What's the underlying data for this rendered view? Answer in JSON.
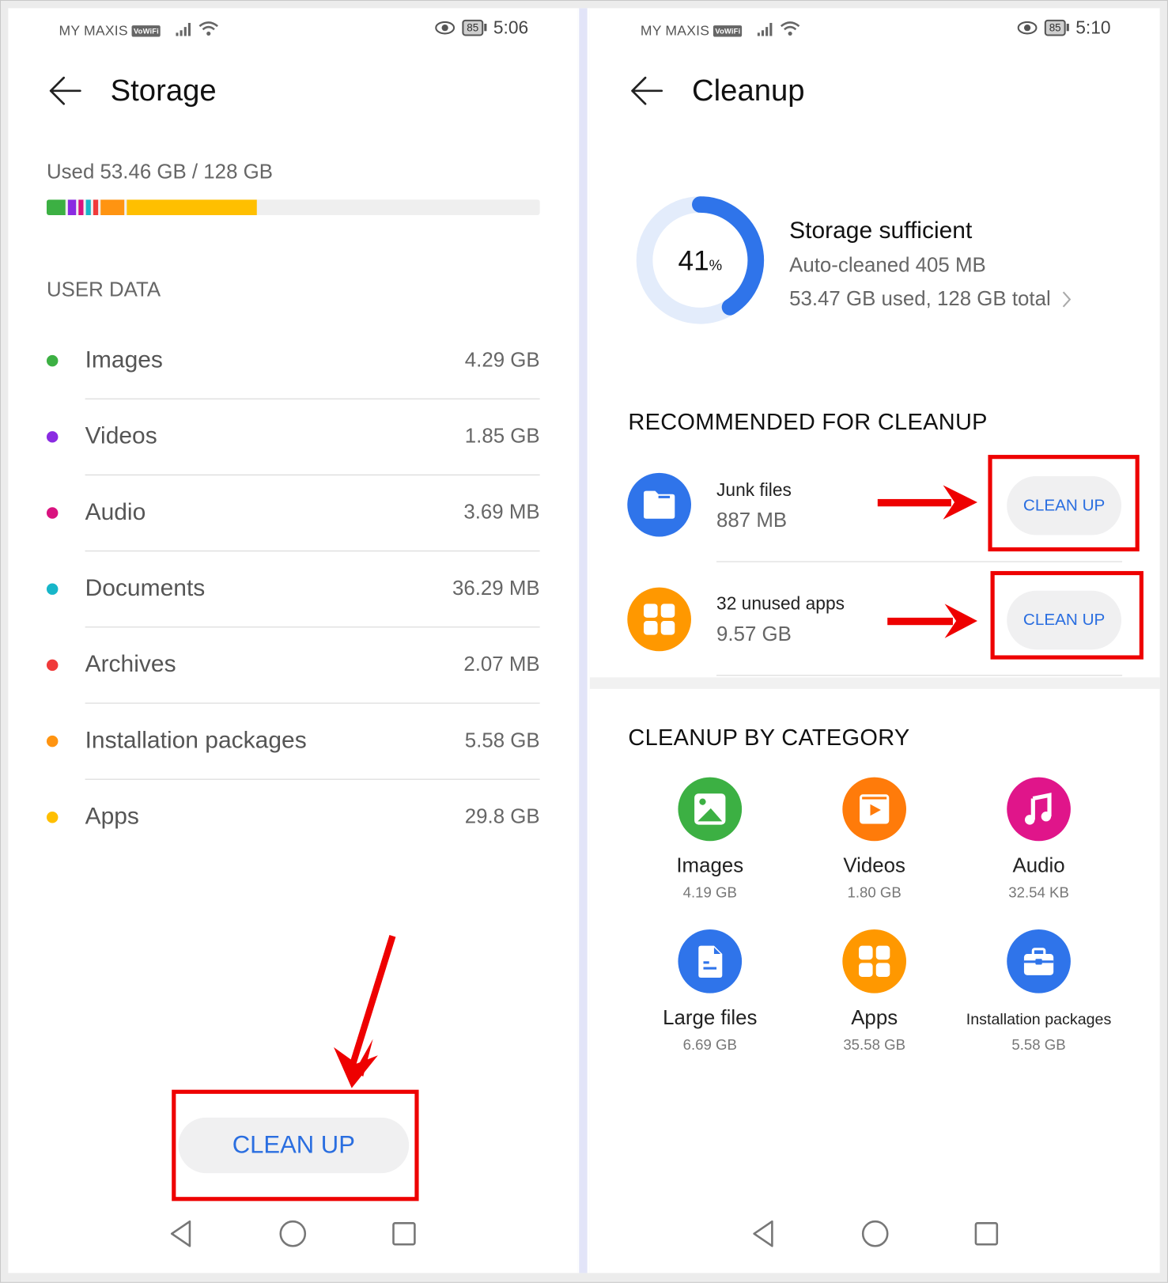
{
  "left_screen": {
    "status_bar": {
      "carrier": "MY MAXIS",
      "vowifi": "VoWiFi",
      "battery": "85",
      "time": "5:06"
    },
    "header": {
      "title": "Storage"
    },
    "usage": {
      "label": "Used 53.46 GB / 128 GB",
      "used_gb": 53.46,
      "total_gb": 128,
      "segments": [
        {
          "name": "Images",
          "color": "#3cb043"
        },
        {
          "name": "Videos",
          "color": "#8a2be2"
        },
        {
          "name": "Audio",
          "color": "#d9127f"
        },
        {
          "name": "Documents",
          "color": "#17b6c9"
        },
        {
          "name": "Archives",
          "color": "#f03a3a"
        },
        {
          "name": "Installation packages",
          "color": "#ff9411"
        },
        {
          "name": "Apps",
          "color": "#ffbf00"
        }
      ]
    },
    "section_title": "USER DATA",
    "items": [
      {
        "label": "Images",
        "value": "4.29 GB",
        "color": "#3cb043"
      },
      {
        "label": "Videos",
        "value": "1.85 GB",
        "color": "#8a2be2"
      },
      {
        "label": "Audio",
        "value": "3.69 MB",
        "color": "#d9127f"
      },
      {
        "label": "Documents",
        "value": "36.29 MB",
        "color": "#17b6c9"
      },
      {
        "label": "Archives",
        "value": "2.07 MB",
        "color": "#f03a3a"
      },
      {
        "label": "Installation packages",
        "value": "5.58 GB",
        "color": "#ff9411"
      },
      {
        "label": "Apps",
        "value": "29.8 GB",
        "color": "#ffbf00"
      }
    ],
    "clean_up_button": "CLEAN UP"
  },
  "right_screen": {
    "status_bar": {
      "carrier": "MY MAXIS",
      "vowifi": "VoWiFi",
      "battery": "85",
      "time": "5:10"
    },
    "header": {
      "title": "Cleanup"
    },
    "summary": {
      "percent": "41",
      "percent_sign": "%",
      "percent_value": 41,
      "status": "Storage sufficient",
      "auto_cleaned": "Auto-cleaned 405 MB",
      "usage": "53.47 GB used, 128 GB total"
    },
    "recommended": {
      "title": "RECOMMENDED FOR CLEANUP",
      "items": [
        {
          "label": "Junk files",
          "size": "887 MB",
          "button": "CLEAN UP",
          "icon": "folder-icon",
          "color": "#2f74ea"
        },
        {
          "label": "32 unused apps",
          "size": "9.57 GB",
          "button": "CLEAN UP",
          "icon": "apps-grid-icon",
          "color": "#ff9800"
        }
      ]
    },
    "categories": {
      "title": "CLEANUP BY CATEGORY",
      "items": [
        {
          "label": "Images",
          "size": "4.19 GB",
          "icon": "image-icon",
          "color": "#3cb043"
        },
        {
          "label": "Videos",
          "size": "1.80 GB",
          "icon": "video-icon",
          "color": "#ff7b0a"
        },
        {
          "label": "Audio",
          "size": "32.54 KB",
          "icon": "music-note-icon",
          "color": "#e0158a"
        },
        {
          "label": "Large files",
          "size": "6.69 GB",
          "icon": "document-icon",
          "color": "#2f74ea"
        },
        {
          "label": "Apps",
          "size": "35.58 GB",
          "icon": "apps-grid-icon",
          "color": "#ff9800"
        },
        {
          "label": "Installation packages",
          "size": "5.58 GB",
          "icon": "toolbox-icon",
          "color": "#2f74ea"
        }
      ]
    }
  },
  "colors": {
    "accent_blue": "#2a6ee0",
    "annotation_red": "#ee0000",
    "ring_track": "#e3ecfb",
    "ring_fill": "#2f74ea"
  }
}
